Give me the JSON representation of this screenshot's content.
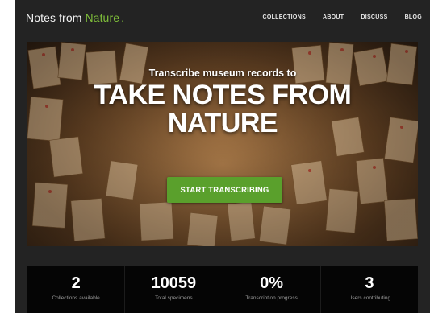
{
  "header": {
    "logo_text": "Notes from",
    "logo_accent": "Nature",
    "logo_dot": ".",
    "nav": [
      "COLLECTIONS",
      "ABOUT",
      "DISCUSS",
      "BLOG"
    ]
  },
  "hero": {
    "subtitle": "Transcribe museum records to",
    "title_line1": "TAKE NOTES FROM",
    "title_line2": "NATURE",
    "cta_label": "START TRANSCRIBING"
  },
  "stats": [
    {
      "value": "2",
      "label": "Collections available"
    },
    {
      "value": "10059",
      "label": "Total specimens"
    },
    {
      "value": "0%",
      "label": "Transcription progress"
    },
    {
      "value": "3",
      "label": "Users contributing"
    }
  ],
  "colors": {
    "accent": "#7fbf3a",
    "button": "#5aa02c",
    "background": "#232323"
  }
}
